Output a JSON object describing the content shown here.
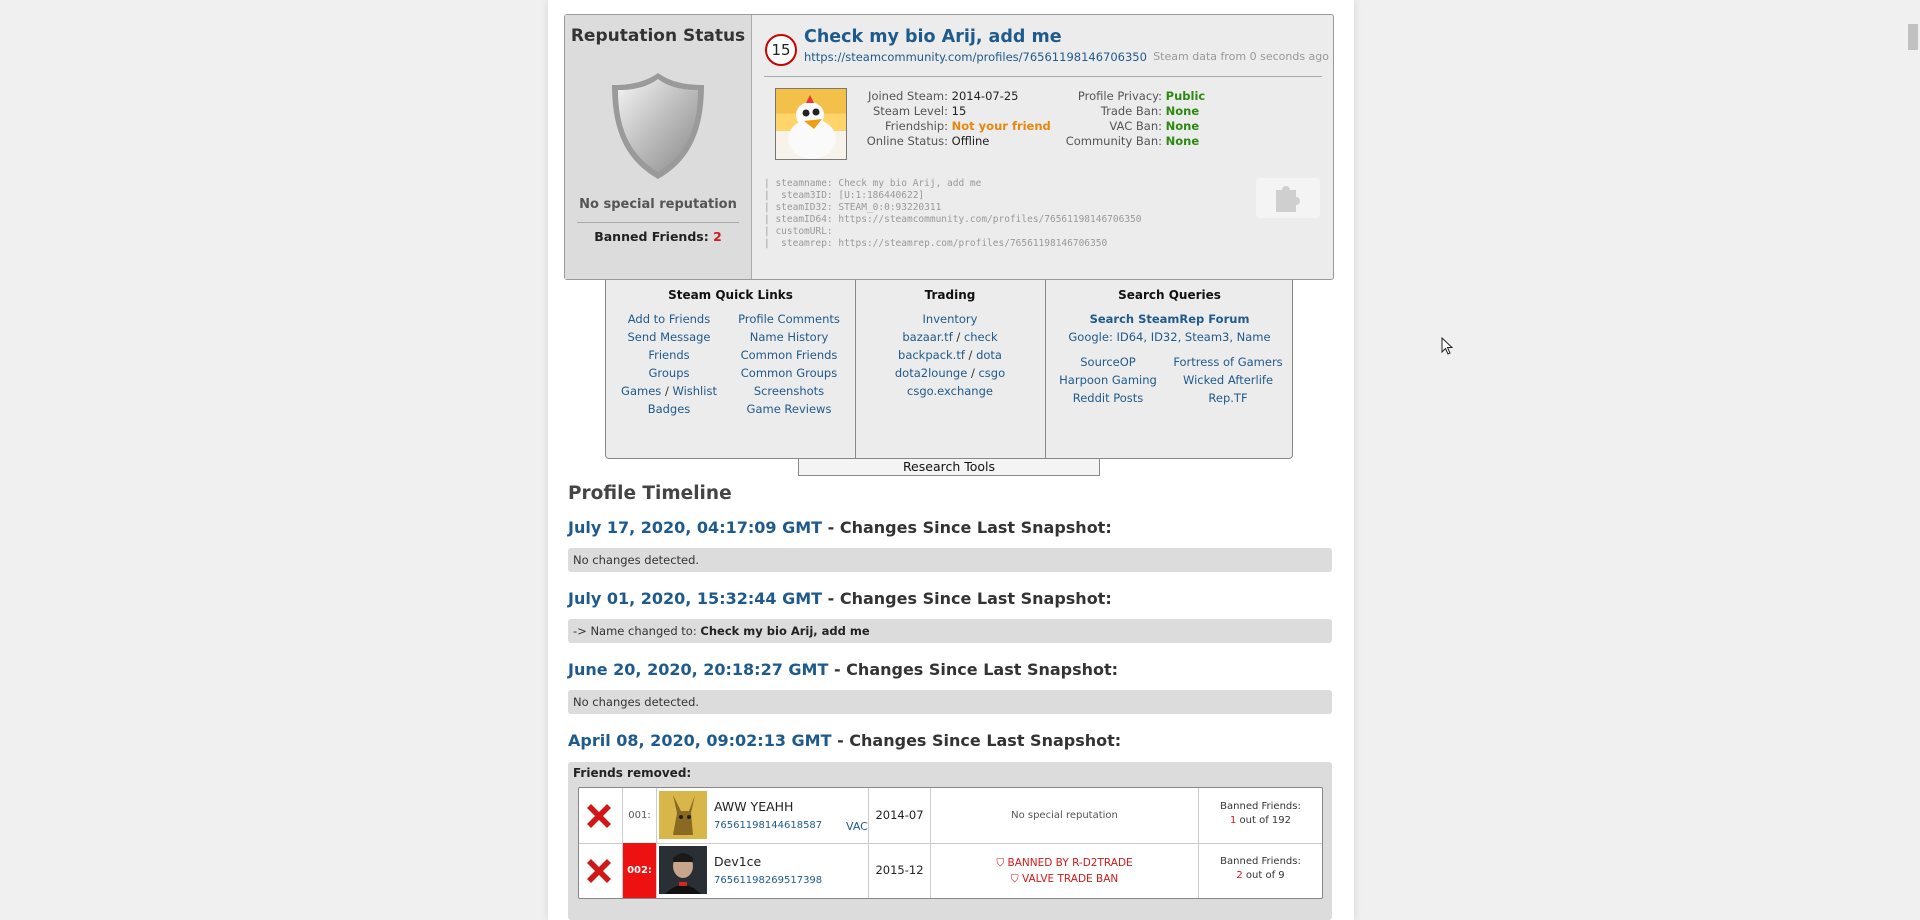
{
  "reputation": {
    "title": "Reputation Status",
    "status": "No special reputation",
    "banned_friends_label": "Banned Friends:",
    "banned_friends_count": "2"
  },
  "profile": {
    "level": "15",
    "name": "Check my bio Arij, add me",
    "url": "https://steamcommunity.com/profiles/76561198146706350",
    "steam_data_note": "Steam data from 0 seconds ago",
    "joined_label": "Joined Steam:",
    "joined": "2014-07-25",
    "level_label": "Steam Level:",
    "level_value": "15",
    "friendship_label": "Friendship:",
    "friendship": "Not your friend",
    "online_label": "Online Status:",
    "online": "Offline",
    "privacy_label": "Profile Privacy:",
    "privacy": "Public",
    "trade_ban_label": "Trade Ban:",
    "trade_ban": "None",
    "vac_ban_label": "VAC Ban:",
    "vac_ban": "None",
    "community_ban_label": "Community Ban:",
    "community_ban": "None",
    "ids": "| steamname: Check my bio Arij, add me\n|  steam3ID: [U:1:186440622]\n| steamID32: STEAM_0:0:93220311\n| steamID64: https://steamcommunity.com/profiles/76561198146706350\n| customURL:\n|  steamrep: https://steamrep.com/profiles/76561198146706350"
  },
  "quick_links": {
    "title": "Steam Quick Links",
    "add_friends": "Add to Friends",
    "send_message": "Send Message",
    "friends": "Friends",
    "groups": "Groups",
    "games": "Games",
    "slash": "/",
    "wishlist": "Wishlist",
    "badges": "Badges",
    "profile_comments": "Profile Comments",
    "name_history": "Name History",
    "common_friends": "Common Friends",
    "common_groups": "Common Groups",
    "screenshots": "Screenshots",
    "game_reviews": "Game Reviews"
  },
  "trading": {
    "title": "Trading",
    "inventory": "Inventory",
    "bazaar": "bazaar.tf",
    "check": "check",
    "backpack": "backpack.tf",
    "dota": "dota",
    "dota2lounge": "dota2lounge",
    "csgo": "csgo",
    "csgo_exchange": "csgo.exchange"
  },
  "search": {
    "title": "Search Queries",
    "steamrep_forum": "Search SteamRep Forum",
    "google": "Google:",
    "id64": "ID64",
    "id32": "ID32",
    "steam3": "Steam3",
    "name": "Name",
    "sourceop": "SourceOP",
    "fortress": "Fortress of Gamers",
    "harpoon": "Harpoon Gaming",
    "wicked": "Wicked Afterlife",
    "reddit": "Reddit Posts",
    "reptf": "Rep.TF",
    "research_tools": "Research Tools"
  },
  "timeline": {
    "title": "Profile Timeline",
    "suffix": "- Changes Since Last Snapshot:",
    "snapshots": [
      {
        "date": "July 17, 2020, 04:17:09 GMT",
        "change": "No changes detected."
      },
      {
        "date": "July 01, 2020, 15:32:44 GMT",
        "change_prefix": "-> Name changed to: ",
        "change_bold": "Check my bio Arij, add me"
      },
      {
        "date": "June 20, 2020, 20:18:27 GMT",
        "change": "No changes detected."
      },
      {
        "date": "April 08, 2020, 09:02:13 GMT"
      }
    ],
    "friends_removed_label": "Friends removed:",
    "friends": [
      {
        "num": "001:",
        "name": "AWW YEAHH",
        "id": "76561198144618587",
        "vac": "VAC",
        "date": "2014-07",
        "rep": "No special reputation",
        "banned_label": "Banned Friends:",
        "banned_count": "1",
        "banned_total": " out of 192"
      },
      {
        "num": "002:",
        "name": "Dev1ce",
        "id": "76561198269517398",
        "date": "2015-12",
        "rep1": "BANNED BY R-D2TRADE",
        "rep2": "VALVE TRADE BAN",
        "banned_label": "Banned Friends:",
        "banned_count": "2",
        "banned_total": " out of 9"
      }
    ]
  }
}
